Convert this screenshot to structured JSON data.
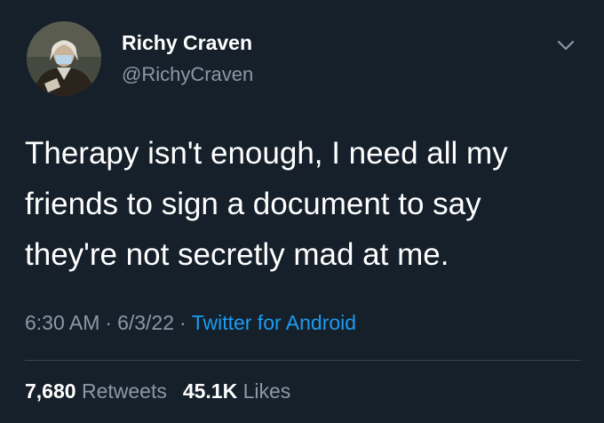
{
  "author": {
    "name": "Richy Craven",
    "handle": "@RichyCraven"
  },
  "tweet": {
    "lines": [
      "Therapy isn't enough, I need all my",
      "friends to sign a document to say",
      "they're not secretly mad at me."
    ]
  },
  "meta": {
    "time": "6:30 AM",
    "separator": "·",
    "date": "6/3/22",
    "source": "Twitter for Android"
  },
  "stats": {
    "retweets_count": "7,680",
    "retweets_label": "Retweets",
    "likes_count": "45.1K",
    "likes_label": "Likes"
  },
  "icons": {
    "menu": "chevron-down-icon"
  },
  "colors": {
    "background": "#15202b",
    "text": "#ffffff",
    "secondary": "#8b98a5",
    "link": "#1d9bf0",
    "divider": "#38444d"
  }
}
